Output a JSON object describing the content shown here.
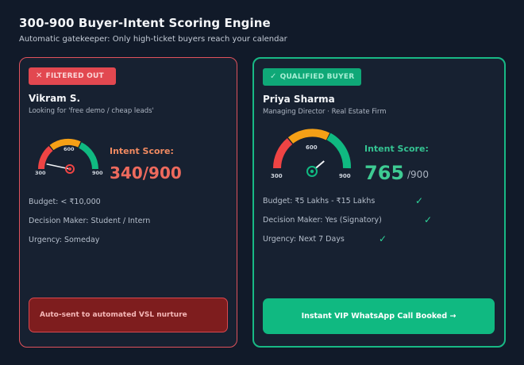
{
  "header": {
    "title": "300-900 Buyer-Intent Scoring Engine",
    "subtitle": "Automatic gatekeeper: Only high-ticket buyers reach your calendar"
  },
  "colors": {
    "background": "#111a29",
    "card": "#172131",
    "rejected": "#e24850",
    "qualified": "#10b981",
    "gauge_red": "#ef4444",
    "gauge_orange": "#f5a016",
    "gauge_green": "#10b981"
  },
  "left_card": {
    "badge_icon": "x-icon",
    "badge_glyph": "✕",
    "badge": "FILTERED OUT",
    "name": "Vikram S.",
    "role": "Looking for 'free demo / cheap leads'",
    "gauge": {
      "min_label": "300",
      "mid_label": "600",
      "max_label": "900",
      "min": 300,
      "max": 900,
      "value": 340
    },
    "score_label": "Intent Score:",
    "score": "340/900",
    "budget": "Budget: < ₹10,000",
    "decision_maker": "Decision Maker: Student / Intern",
    "urgency": "Urgency: Someday",
    "cta": "Auto-sent to automated VSL nurture"
  },
  "right_card": {
    "badge_icon": "check-icon",
    "badge_glyph": "✓",
    "badge": "QUALIFIED BUYER",
    "name": "Priya Sharma",
    "role": "Managing Director · Real Estate Firm",
    "gauge": {
      "min_label": "300",
      "mid_label": "600",
      "max_label": "900",
      "min": 300,
      "max": 900,
      "value": 765
    },
    "score_label": "Intent Score:",
    "score": "765",
    "score_denominator": "/900",
    "budget": "Budget: ₹5 Lakhs - ₹15 Lakhs",
    "decision_maker": "Decision Maker: Yes (Signatory)",
    "urgency": "Urgency: Next 7 Days",
    "check_glyph": "✓",
    "cta": "Instant VIP WhatsApp Call Booked →"
  }
}
